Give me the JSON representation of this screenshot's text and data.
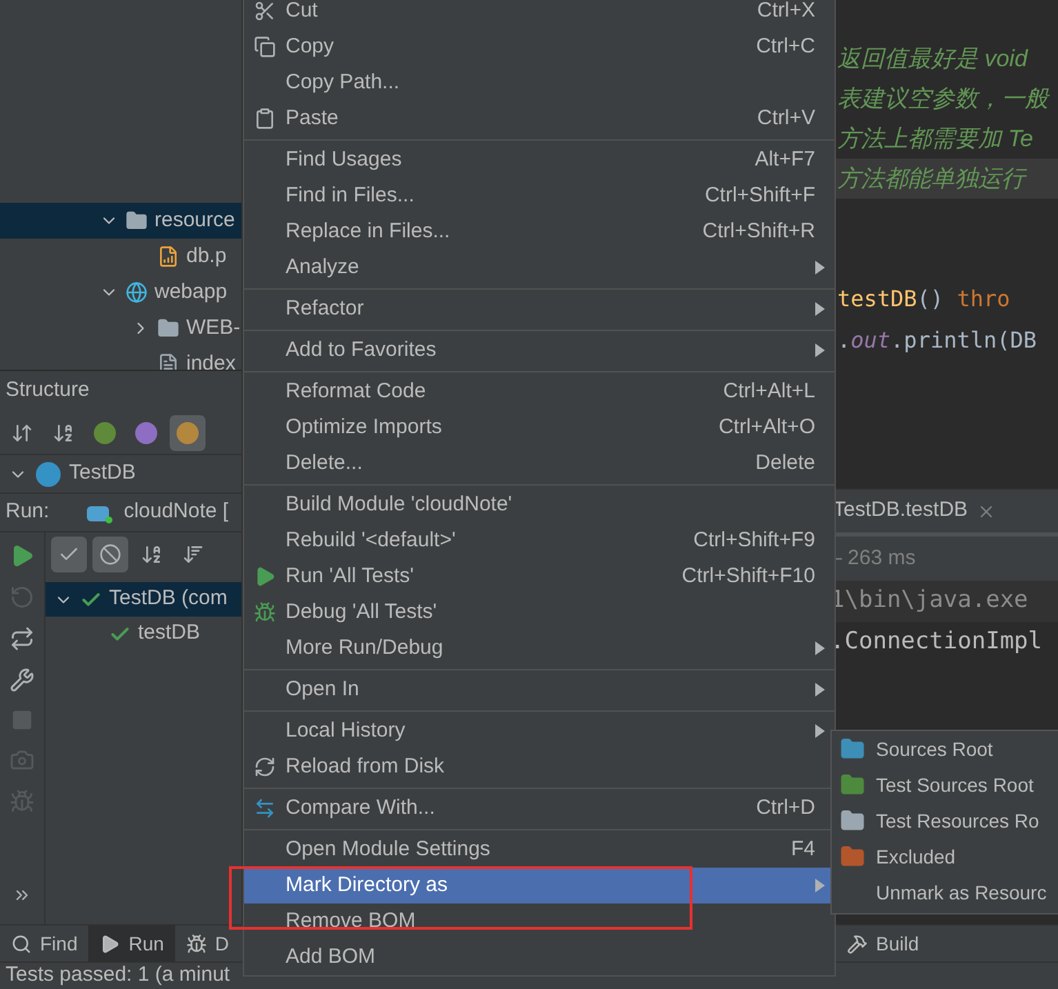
{
  "project_tree": [
    {
      "label": "resource",
      "kind": "resources",
      "expanded": true,
      "selected": true,
      "children": [
        {
          "label": "db.p",
          "kind": "properties",
          "selected": false
        }
      ]
    },
    {
      "label": "webapp",
      "kind": "web",
      "expanded": true,
      "selected": false,
      "children": [
        {
          "label": "WEB-",
          "kind": "folder",
          "expanded": false,
          "selected": false
        },
        {
          "label": "index",
          "kind": "file",
          "selected": false
        }
      ]
    }
  ],
  "structure": {
    "title": "Structure",
    "toolbar": [
      {
        "kind": "sort-visibility",
        "on": false
      },
      {
        "kind": "sort-alpha",
        "on": false
      },
      {
        "kind": "inherited",
        "on": false
      },
      {
        "kind": "properties",
        "on": false
      },
      {
        "kind": "fields",
        "on": true
      }
    ],
    "root": {
      "label": "TestDB",
      "expanded": true
    }
  },
  "run": {
    "label": "Run:",
    "config": "cloudNote [",
    "toolbar": [
      {
        "kind": "passed",
        "on": true
      },
      {
        "kind": "ignored",
        "on": true
      },
      {
        "kind": "sort-alpha",
        "on": false
      },
      {
        "kind": "sort-duration",
        "on": false
      }
    ],
    "tests": [
      {
        "label": "TestDB (com",
        "passed": true,
        "selected": true,
        "expanded": true,
        "children": [
          {
            "label": "testDB",
            "passed": true,
            "selected": false
          }
        ]
      }
    ],
    "tab": "TestDB.testDB",
    "duration": "– 263 ms",
    "console": [
      "1\\bin\\java.exe",
      ".ConnectionImpl"
    ]
  },
  "editor": {
    "comments": [
      {
        "text": "返回值最好是 void",
        "highlighted": false
      },
      {
        "text": "表建议空参数，一般",
        "highlighted": false
      },
      {
        "text": "方法上都需要加 Te",
        "highlighted": false
      },
      {
        "text": "方法都能单独运行",
        "highlighted": true
      }
    ],
    "code": [
      [
        {
          "kind": "function",
          "text": "testDB"
        },
        {
          "kind": "plain",
          "text": "() "
        },
        {
          "kind": "keyword",
          "text": "thro"
        }
      ],
      [
        {
          "kind": "plain",
          "text": "."
        },
        {
          "kind": "static",
          "text": "out"
        },
        {
          "kind": "plain",
          "text": ".println(DB"
        }
      ]
    ]
  },
  "menu": {
    "items": [
      {
        "kind": "cut",
        "label": "Cut",
        "shortcut": "Ctrl+X",
        "submenu": false,
        "selected": false
      },
      {
        "kind": "copy",
        "label": "Copy",
        "shortcut": "Ctrl+C",
        "submenu": false,
        "selected": false
      },
      {
        "kind": "plain",
        "label": "Copy Path...",
        "submenu": false,
        "selected": false
      },
      {
        "kind": "paste",
        "label": "Paste",
        "shortcut": "Ctrl+V",
        "submenu": false,
        "selected": false
      },
      {
        "kind": "separator"
      },
      {
        "kind": "plain",
        "label": "Find Usages",
        "shortcut": "Alt+F7",
        "submenu": false,
        "selected": false
      },
      {
        "kind": "plain",
        "label": "Find in Files...",
        "shortcut": "Ctrl+Shift+F",
        "submenu": false,
        "selected": false
      },
      {
        "kind": "plain",
        "label": "Replace in Files...",
        "shortcut": "Ctrl+Shift+R",
        "submenu": false,
        "selected": false
      },
      {
        "kind": "plain",
        "label": "Analyze",
        "submenu": true,
        "selected": false
      },
      {
        "kind": "separator"
      },
      {
        "kind": "plain",
        "label": "Refactor",
        "submenu": true,
        "selected": false
      },
      {
        "kind": "separator"
      },
      {
        "kind": "plain",
        "label": "Add to Favorites",
        "submenu": true,
        "selected": false
      },
      {
        "kind": "separator"
      },
      {
        "kind": "plain",
        "label": "Reformat Code",
        "shortcut": "Ctrl+Alt+L",
        "submenu": false,
        "selected": false
      },
      {
        "kind": "plain",
        "label": "Optimize Imports",
        "shortcut": "Ctrl+Alt+O",
        "submenu": false,
        "selected": false
      },
      {
        "kind": "plain",
        "label": "Delete...",
        "shortcut": "Delete",
        "submenu": false,
        "selected": false
      },
      {
        "kind": "separator"
      },
      {
        "kind": "plain",
        "label": "Build Module 'cloudNote'",
        "submenu": false,
        "selected": false
      },
      {
        "kind": "plain",
        "label": "Rebuild '<default>'",
        "shortcut": "Ctrl+Shift+F9",
        "submenu": false,
        "selected": false
      },
      {
        "kind": "run",
        "label": "Run 'All Tests'",
        "shortcut": "Ctrl+Shift+F10",
        "submenu": false,
        "selected": false
      },
      {
        "kind": "debug",
        "label": "Debug 'All Tests'",
        "submenu": false,
        "selected": false
      },
      {
        "kind": "plain",
        "label": "More Run/Debug",
        "submenu": true,
        "selected": false
      },
      {
        "kind": "separator"
      },
      {
        "kind": "plain",
        "label": "Open In",
        "submenu": true,
        "selected": false
      },
      {
        "kind": "separator"
      },
      {
        "kind": "plain",
        "label": "Local History",
        "submenu": true,
        "selected": false
      },
      {
        "kind": "reload",
        "label": "Reload from Disk",
        "submenu": false,
        "selected": false
      },
      {
        "kind": "separator"
      },
      {
        "kind": "compare",
        "label": "Compare With...",
        "shortcut": "Ctrl+D",
        "submenu": false,
        "selected": false
      },
      {
        "kind": "separator"
      },
      {
        "kind": "plain",
        "label": "Open Module Settings",
        "shortcut": "F4",
        "submenu": false,
        "selected": false
      },
      {
        "kind": "plain",
        "label": "Mark Directory as",
        "submenu": true,
        "selected": true
      },
      {
        "kind": "plain",
        "label": "Remove BOM",
        "submenu": false,
        "selected": false
      },
      {
        "kind": "plain",
        "label": "Add BOM",
        "submenu": false,
        "selected": false
      }
    ]
  },
  "submenu": {
    "items": [
      {
        "kind": "sources",
        "label": "Sources Root",
        "selected": false
      },
      {
        "kind": "test-sources",
        "label": "Test Sources Root",
        "selected": false
      },
      {
        "kind": "test-resources",
        "label": "Test Resources Ro",
        "selected": false
      },
      {
        "kind": "excluded",
        "label": "Excluded",
        "selected": false
      },
      {
        "kind": "plain",
        "label": "Unmark as Resourc",
        "selected": false
      }
    ]
  },
  "bottom_tools": [
    {
      "kind": "find",
      "label": "Find",
      "selected": false
    },
    {
      "kind": "run",
      "label": "Run",
      "selected": true
    },
    {
      "kind": "debug",
      "label": "D",
      "selected": false
    },
    {
      "kind": "build",
      "label": "Build",
      "selected": false
    }
  ],
  "status_bar": "Tests passed: 1 (a minut"
}
